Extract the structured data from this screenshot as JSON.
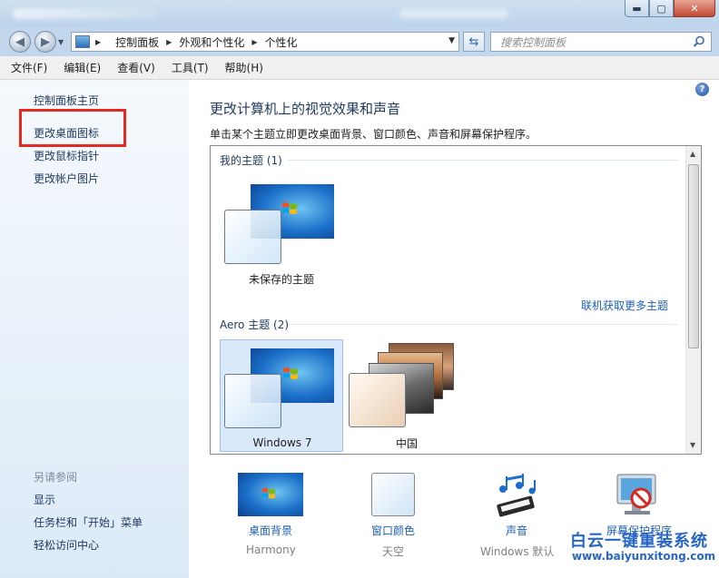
{
  "window": {
    "buttons": {
      "minimize": "▬",
      "maximize": "▢",
      "close": "✕"
    }
  },
  "address": {
    "crumbs": [
      "控制面板",
      "外观和个性化",
      "个性化"
    ],
    "search_placeholder": "搜索控制面板"
  },
  "menu": [
    "文件(F)",
    "编辑(E)",
    "查看(V)",
    "工具(T)",
    "帮助(H)"
  ],
  "sidebar": {
    "links": [
      "控制面板主页",
      "更改桌面图标",
      "更改鼠标指针",
      "更改帐户图片"
    ],
    "see_also_title": "另请参阅",
    "see_also": [
      "显示",
      "任务栏和「开始」菜单",
      "轻松访问中心"
    ]
  },
  "main": {
    "title": "更改计算机上的视觉效果和声音",
    "subtitle": "单击某个主题立即更改桌面背景、窗口颜色、声音和屏幕保护程序。",
    "my_themes_title": "我的主题 (1)",
    "my_themes": [
      {
        "label": "未保存的主题"
      }
    ],
    "more_online": "联机获取更多主题",
    "aero_title": "Aero 主题 (2)",
    "aero_themes": [
      {
        "label": "Windows 7",
        "selected": true
      },
      {
        "label": "中国",
        "selected": false
      }
    ]
  },
  "bottom": [
    {
      "label": "桌面背景",
      "sub": "Harmony",
      "icon": "desktop-background-icon"
    },
    {
      "label": "窗口颜色",
      "sub": "天空",
      "icon": "window-color-icon"
    },
    {
      "label": "声音",
      "sub": "Windows 默认",
      "icon": "sound-icon"
    },
    {
      "label": "屏幕保护程序",
      "sub": "",
      "icon": "screensaver-icon"
    }
  ],
  "watermark": {
    "title": "白云一键重装系统",
    "url": "www.baiyunxitong.com"
  },
  "colors": {
    "accent": "#1e395b",
    "link": "#1e5fb4",
    "highlight": "#e52a22",
    "watermark": "#2866c6"
  }
}
